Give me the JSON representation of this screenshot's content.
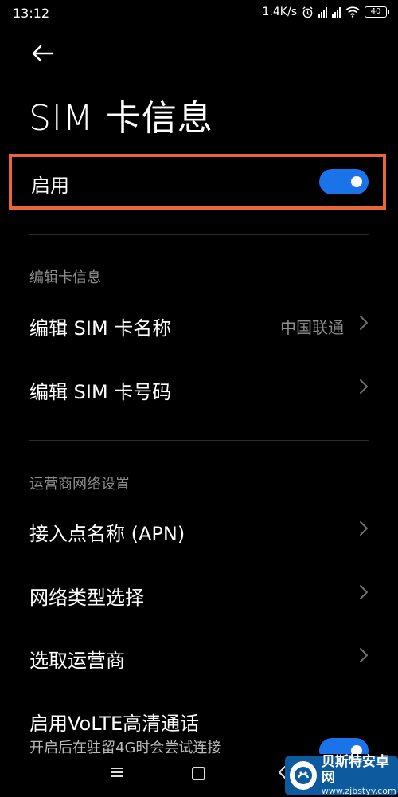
{
  "status_bar": {
    "time": "13:12",
    "speed": "1.4K/s",
    "battery": "40"
  },
  "page": {
    "title": "SIM 卡信息"
  },
  "enable": {
    "label": "启用",
    "on": true
  },
  "sections": {
    "edit_header": "编辑卡信息",
    "carrier_header": "运营商网络设置"
  },
  "rows": {
    "edit_name": {
      "label": "编辑 SIM 卡名称",
      "value": "中国联通"
    },
    "edit_number": {
      "label": "编辑 SIM 卡号码"
    },
    "apn": {
      "label": "接入点名称 (APN)"
    },
    "network_type": {
      "label": "网络类型选择"
    },
    "select_carrier": {
      "label": "选取运营商"
    },
    "volte": {
      "label": "启用VoLTE高清通话",
      "subtitle": "开启后在驻留4G时会尝试连接",
      "on": true
    }
  },
  "watermark": {
    "name": "贝斯特安卓网",
    "url": "www.zjbstyy.com"
  },
  "colors": {
    "accent": "#1a73e8",
    "highlight": "#e8673a",
    "background": "#000000"
  }
}
